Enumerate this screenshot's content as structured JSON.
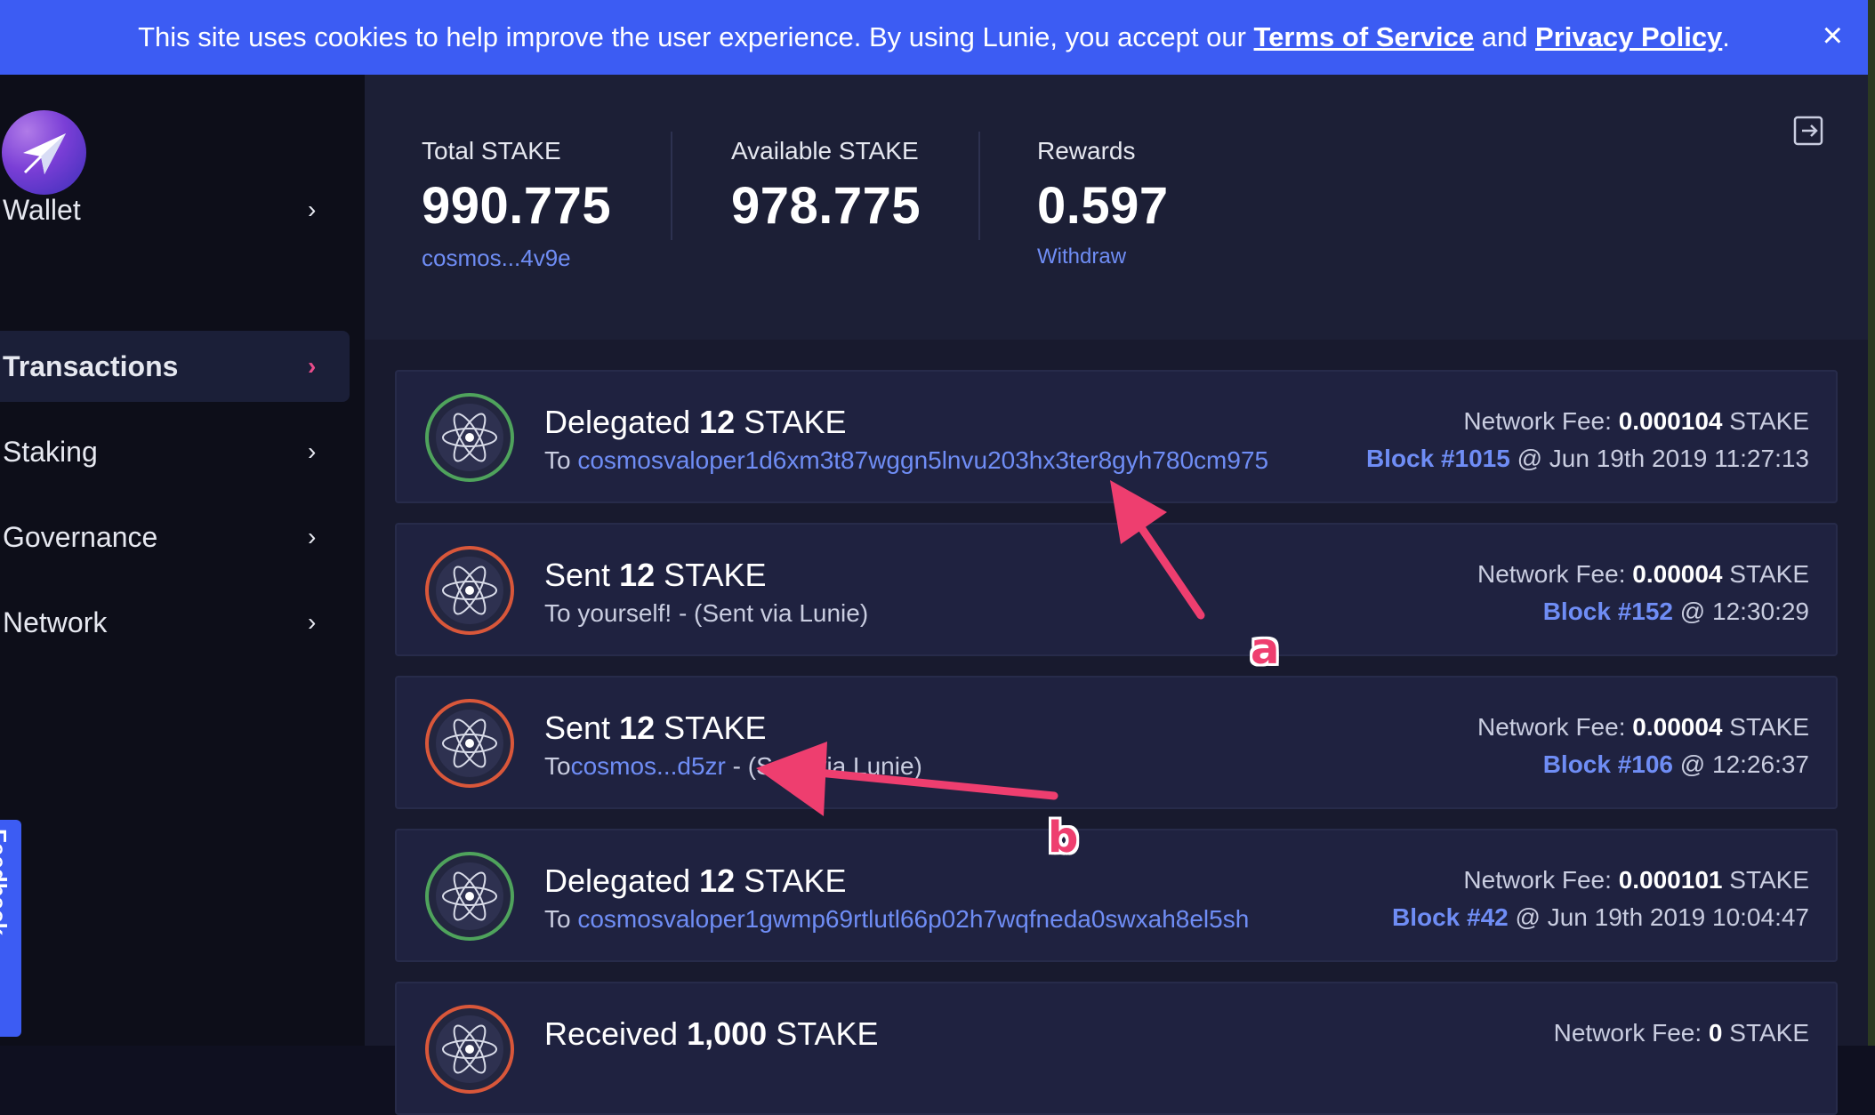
{
  "cookie_banner": {
    "text_before": "This site uses cookies to help improve the user experience. By using Lunie, you accept our ",
    "terms_link": "Terms of Service",
    "and_text": " and ",
    "privacy_link": "Privacy Policy",
    "text_after": ".",
    "close_icon": "×"
  },
  "sidebar": {
    "logo_icon": "lunie-paper-plane-logo",
    "items": [
      {
        "label": "Wallet",
        "chevron": "›"
      },
      {
        "label": "Transactions",
        "chevron": "›"
      },
      {
        "label": "Staking",
        "chevron": "›"
      },
      {
        "label": "Governance",
        "chevron": "›"
      },
      {
        "label": "Network",
        "chevron": "›"
      }
    ],
    "feedback_label": "Feedback"
  },
  "header": {
    "total": {
      "label": "Total STAKE",
      "value": "990.775",
      "address": "cosmos...4v9e"
    },
    "available": {
      "label": "Available STAKE",
      "value": "978.775"
    },
    "rewards": {
      "label": "Rewards",
      "value": "0.597",
      "action": "Withdraw"
    },
    "signout_icon": "sign-out-icon"
  },
  "transactions": [
    {
      "action": "Delegated ",
      "amount": "12",
      "denom": " STAKE",
      "to_prefix": "To ",
      "to_link": "cosmosvaloper1d6xm3t87wggn5lnvu203hx3ter8gyh780cm975",
      "to_suffix": "",
      "fee_label": "Network Fee: ",
      "fee_value": "0.000104",
      "fee_denom": " STAKE",
      "block": "Block #1015",
      "time": " @ Jun 19th 2019 11:27:13",
      "icon_color": "#4fa35c"
    },
    {
      "action": "Sent ",
      "amount": "12",
      "denom": " STAKE",
      "to_prefix": "To yourself! - (Sent via Lunie)",
      "to_link": "",
      "to_suffix": "",
      "fee_label": "Network Fee: ",
      "fee_value": "0.00004",
      "fee_denom": " STAKE",
      "block": "Block #152",
      "time": " @ 12:30:29",
      "icon_color": "#d9573a"
    },
    {
      "action": "Sent ",
      "amount": "12",
      "denom": " STAKE",
      "to_prefix": "To",
      "to_link": "cosmos...d5zr",
      "to_suffix": " - (Sent via Lunie)",
      "fee_label": "Network Fee: ",
      "fee_value": "0.00004",
      "fee_denom": " STAKE",
      "block": "Block #106",
      "time": " @ 12:26:37",
      "icon_color": "#d9573a"
    },
    {
      "action": "Delegated ",
      "amount": "12",
      "denom": " STAKE",
      "to_prefix": "To ",
      "to_link": "cosmosvaloper1gwmp69rtlutl66p02h7wqfneda0swxah8el5sh",
      "to_suffix": "",
      "fee_label": "Network Fee: ",
      "fee_value": "0.000101",
      "fee_denom": " STAKE",
      "block": "Block #42",
      "time": " @ Jun 19th 2019 10:04:47",
      "icon_color": "#4fa35c"
    },
    {
      "action": "Received ",
      "amount": "1,000",
      "denom": " STAKE",
      "to_prefix": "",
      "to_link": "",
      "to_suffix": "",
      "fee_label": "Network Fee: ",
      "fee_value": "0",
      "fee_denom": " STAKE",
      "block": "",
      "time": "",
      "icon_color": "#d9573a"
    }
  ],
  "annotations": {
    "a": "a",
    "b": "b",
    "color": "#ee3e6f"
  }
}
